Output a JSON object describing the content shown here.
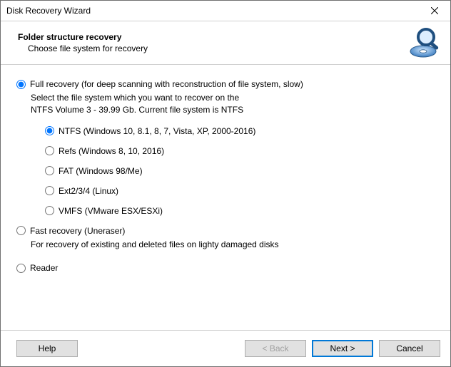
{
  "window": {
    "title": "Disk Recovery Wizard"
  },
  "header": {
    "title": "Folder structure recovery",
    "subtitle": "Choose file system for recovery"
  },
  "modes": {
    "full": {
      "label": "Full recovery (for deep scanning with reconstruction of file system, slow)",
      "desc_line1": "Select the file system which you want to recover on the",
      "desc_line2": "NTFS Volume 3 - 39.99 Gb. Current file system is NTFS",
      "filesystems": {
        "ntfs": "NTFS (Windows 10, 8.1, 8, 7, Vista, XP, 2000-2016)",
        "refs": "Refs (Windows 8, 10, 2016)",
        "fat": "FAT (Windows 98/Me)",
        "ext": "Ext2/3/4 (Linux)",
        "vmfs": "VMFS (VMware ESX/ESXi)"
      }
    },
    "fast": {
      "label": "Fast recovery (Uneraser)",
      "desc": "For recovery of existing and deleted files on lighty damaged disks"
    },
    "reader": {
      "label": "Reader"
    }
  },
  "footer": {
    "help": "Help",
    "back": "< Back",
    "next": "Next >",
    "cancel": "Cancel"
  }
}
